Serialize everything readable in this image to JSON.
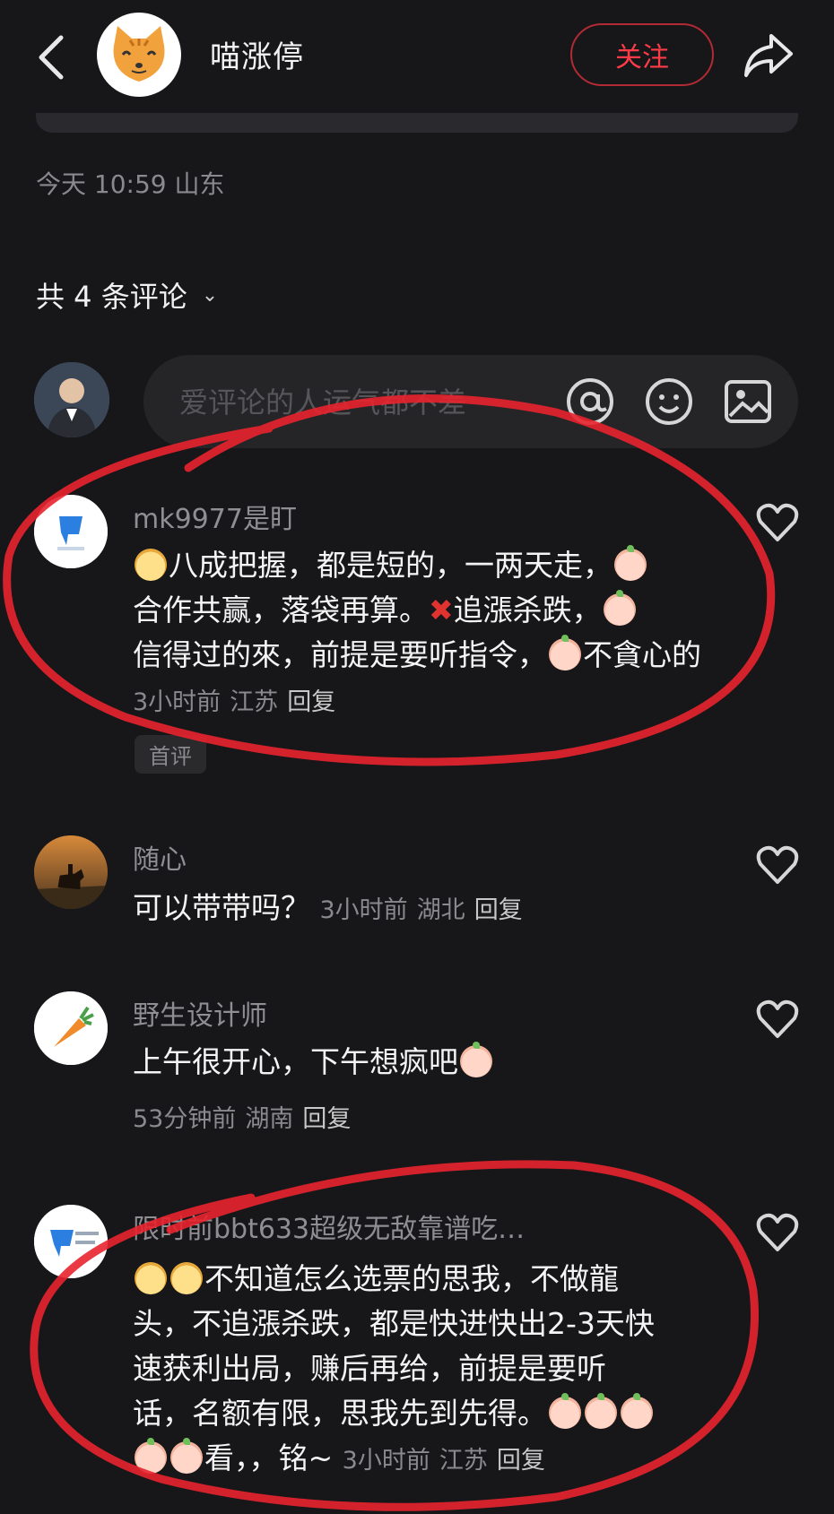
{
  "header": {
    "title": "喵涨停",
    "follow_label": "关注"
  },
  "post_meta": "今天 10:59 山东",
  "comment_count_label": "共 4 条评论",
  "input_placeholder": "爱评论的人运气都不差",
  "comments": [
    {
      "user": "mk9977是盯",
      "parts": [
        "八成把握，都是短的，一两天走，",
        "合作共赢，落袋再算。",
        "追漲杀跌，",
        "信得过的來，前提是要听指令，",
        "不貪心的"
      ],
      "time": "3小时前",
      "location": "江苏",
      "reply": "回复",
      "tag": "首评"
    },
    {
      "user": "随心",
      "text": "可以带带吗？",
      "time": "3小时前",
      "location": "湖北",
      "reply": "回复"
    },
    {
      "user": "野生设计师",
      "text": "上午很开心，下午想疯吧",
      "time": "53分钟前",
      "location": "湖南",
      "reply": "回复"
    },
    {
      "user": "限时前bbt633超级无敌靠谱吃…",
      "parts": [
        "不知道怎么选票的思我，不做龍",
        "头，不追漲杀跌，都是快进快出2-3天快",
        "速获利出局，赚后再给，前提是要听",
        "话，名额有限，思我先到先得。",
        "看，，铭~"
      ],
      "time": "3小时前",
      "location": "江苏",
      "reply": "回复"
    }
  ],
  "icons": {
    "back": "chevron-left-icon",
    "share": "share-arrow-icon",
    "at": "at-icon",
    "emoji": "smiley-icon",
    "image": "image-icon",
    "like": "heart-icon"
  },
  "colors": {
    "background": "#17171a",
    "follow": "#ff3b48",
    "annotation": "#e8232e"
  }
}
